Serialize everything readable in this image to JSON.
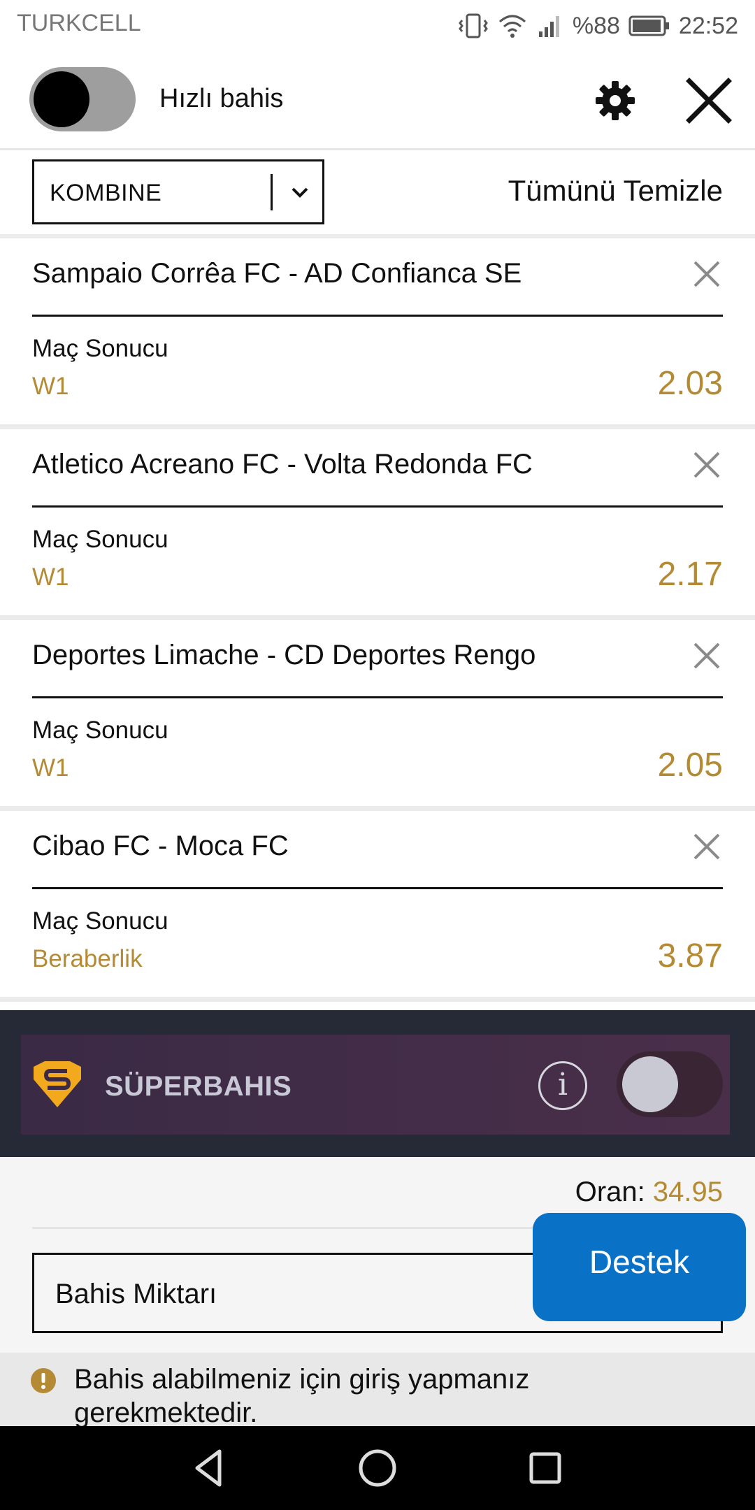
{
  "status_bar": {
    "carrier": "TURKCELL",
    "battery": "%88",
    "time": "22:52"
  },
  "header": {
    "quick_bet_label": "Hızlı bahis",
    "quick_bet_on": false
  },
  "filter": {
    "bet_type": "KOMBINE",
    "clear_all": "Tümünü Temizle"
  },
  "bets": [
    {
      "match": "Sampaio Corrêa FC - AD Confianca SE",
      "market": "Maç Sonucu",
      "pick": "W1",
      "odd": "2.03"
    },
    {
      "match": "Atletico Acreano FC - Volta Redonda FC",
      "market": "Maç Sonucu",
      "pick": "W1",
      "odd": "2.17"
    },
    {
      "match": "Deportes Limache - CD Deportes Rengo",
      "market": "Maç Sonucu",
      "pick": "W1",
      "odd": "2.05"
    },
    {
      "match": "Cibao FC - Moca FC",
      "market": "Maç Sonucu",
      "pick": "Beraberlik",
      "odd": "3.87"
    }
  ],
  "superbahis": {
    "title": "SÜPERBAHIS",
    "info_glyph": "i",
    "enabled": false
  },
  "summary": {
    "odds_label": "Oran:",
    "odds_value": "34.95",
    "amount_placeholder": "Bahis Miktarı",
    "support_label": "Destek"
  },
  "notice": {
    "text": "Bahis alabilmeniz için giriş yapmanız gerekmektedir."
  },
  "colors": {
    "accent_gold": "#b58a34",
    "support_blue": "#0a72c6",
    "super_band": "#262a37"
  }
}
